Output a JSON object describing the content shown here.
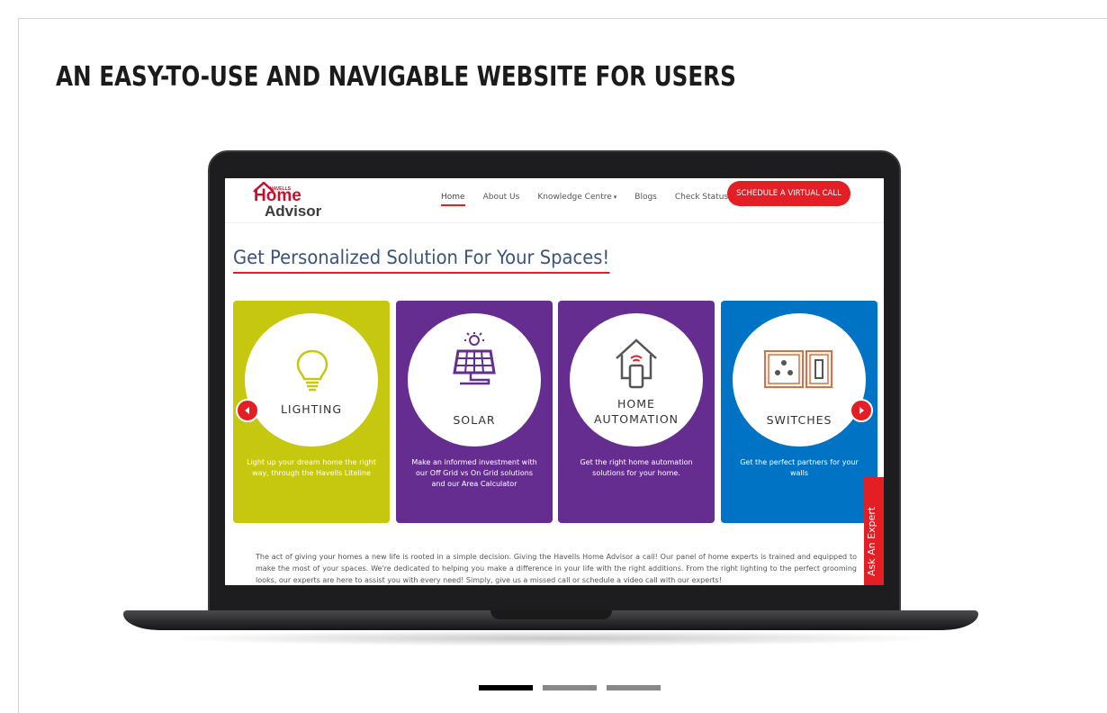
{
  "headline": "An easy-to-use and navigable website for users",
  "site": {
    "logo": {
      "brand": "HAVELLS",
      "line1": "Home",
      "line2": "Advisor"
    },
    "nav": [
      {
        "label": "Home",
        "active": true
      },
      {
        "label": "About Us"
      },
      {
        "label": "Knowledge Centre",
        "dropdown": true
      },
      {
        "label": "Blogs"
      },
      {
        "label": "Check Status"
      }
    ],
    "cta": "SCHEDULE A VIRTUAL CALL",
    "title": "Get Personalized Solution For Your Spaces!",
    "cards": [
      {
        "label": "LIGHTING",
        "desc": "Light up your dream home the right way, through the Havells Liteline",
        "color": "#c6c70f",
        "icon": "bulb-icon"
      },
      {
        "label": "SOLAR",
        "desc": "Make an informed investment with our Off Grid vs On Grid solutions and our Area Calculator",
        "color": "#662d91",
        "icon": "solar-panel-icon"
      },
      {
        "label": "HOME\nAUTOMATION",
        "desc": "Get the right home automation solutions for your home.",
        "color": "#662d91",
        "icon": "smart-home-icon"
      },
      {
        "label": "SWITCHES",
        "desc": "Get the perfect partners for your walls",
        "color": "#0073c4",
        "icon": "switch-plate-icon"
      }
    ],
    "expert_tab": "Ask An Expert",
    "body_text": "The act of giving your homes a new life is rooted in a simple decision. Giving the Havells Home Advisor a call! Our panel of home experts is trained and equipped to make the most of your spaces. We're dedicated to helping you make a difference in your life with the right additions. From the right lighting to the perfect grooming looks, our experts are here to assist you with every need! Simply, give us a missed call or schedule a video call with our experts!"
  },
  "pager": {
    "count": 3,
    "active": 1
  },
  "colors": {
    "accent": "#e31e24",
    "title": "#3d5277"
  }
}
